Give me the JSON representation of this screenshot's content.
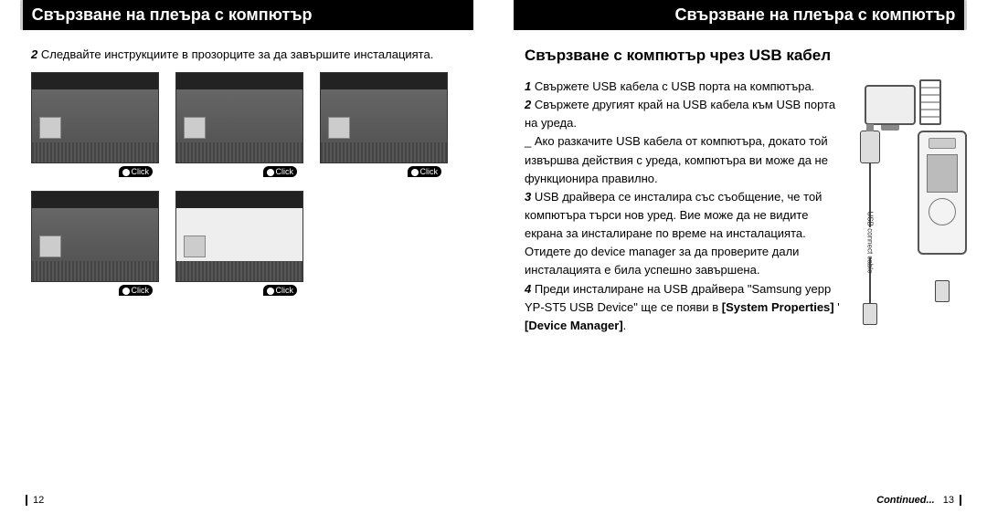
{
  "left": {
    "header": "Свързване на плеъра с компютър",
    "instr_num": "2",
    "instr_text": "Следвайте инструкциите в прозорците за да завършите инсталацията.",
    "click_label": "Click",
    "page_num": "12"
  },
  "right": {
    "header": "Свързване на плеъра с компютър",
    "section_title": "Свързване с компютър чрез USB кабел",
    "p1_num": "1",
    "p1_text": "Свържете USB кабела с USB порта на компютъра.",
    "p2_num": "2",
    "p2_text": "Свържете другият край на USB кабела към USB порта на уреда.",
    "p2_note": "_ Ако разкачите USB кабела от компютъра, докато той извършва действия с уреда,  компютъра ви може да не функционира правилно.",
    "p3_num": "3",
    "p3_text": "USB драйвера се инсталира със съобщение, че той компютъра търси нов уред. Вие може да не видите екрана за инсталиране по време на инсталацията. Отидете до device manager за да проверите дали инсталацията е била успешно завършена.",
    "p4_num": "4",
    "p4_text_a": "Преди инсталиране на USB драйвера \"Samsung yepp YP-ST5 USB Device\" ще се появи в ",
    "p4_bold1": "[System Properties]",
    "p4_mid": " ' ",
    "p4_bold2": "[Device Manager]",
    "p4_end": ".",
    "cable_label": "USB connect cable",
    "continued": "Continued...",
    "page_num": "13"
  }
}
